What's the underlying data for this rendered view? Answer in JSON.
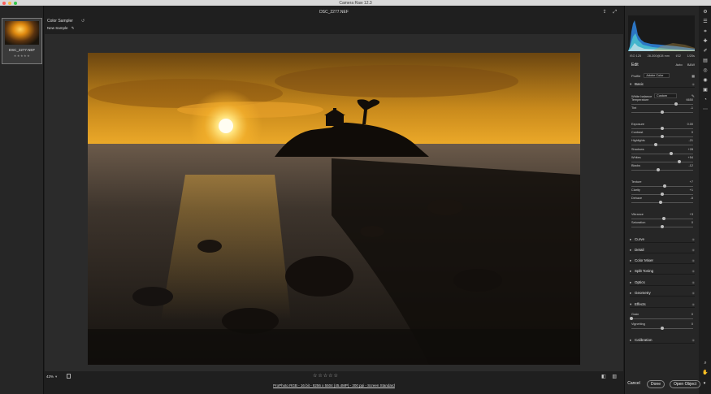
{
  "app": {
    "title": "Camera Raw 12.3"
  },
  "document": {
    "filename": "DSC_2277.NEF"
  },
  "filmstrip": {
    "items": [
      {
        "name": "DSC_2277.NEF",
        "stars": "★★★★★"
      }
    ]
  },
  "color_sampler": {
    "label": "Color Sampler",
    "new_sample": "New Sample"
  },
  "canvas": {
    "zoom": "43%",
    "rating_stars": "☆☆☆☆☆"
  },
  "workflow_options": "ProPhoto RGB - 16 bit - 8256 x 5504 (45.4MP) - 300 ppi - Screen Standard",
  "histogram": {
    "camera_info": [
      "ISO 125",
      "28-300@28 mm",
      "f/22",
      "1/20s"
    ],
    "colors": {
      "blue": "#3aa0ff",
      "cyan": "#44dddd",
      "white": "#eeeeee"
    }
  },
  "edit": {
    "title": "Edit",
    "auto_label": "Auto",
    "bw_label": "B&W",
    "profile_label": "Profile",
    "profile_value": "Adobe Color"
  },
  "basic": {
    "title": "Basic",
    "white_balance_label": "White balance",
    "white_balance_value": "Custom",
    "sliders": [
      {
        "label": "Temperature",
        "value": "6650",
        "position": 0.72
      },
      {
        "label": "Tint",
        "value": "-1",
        "position": 0.5
      },
      {
        "label": "Exposure",
        "value": "0.00",
        "position": 0.5
      },
      {
        "label": "Contrast",
        "value": "0",
        "position": 0.5
      },
      {
        "label": "Highlights",
        "value": "-21",
        "position": 0.4
      },
      {
        "label": "Shadows",
        "value": "+28",
        "position": 0.64
      },
      {
        "label": "Whites",
        "value": "+54",
        "position": 0.77
      },
      {
        "label": "Blacks",
        "value": "-12",
        "position": 0.44
      },
      {
        "label": "Texture",
        "value": "+7",
        "position": 0.54
      },
      {
        "label": "Clarity",
        "value": "+1",
        "position": 0.5
      },
      {
        "label": "Dehaze",
        "value": "-5",
        "position": 0.48
      },
      {
        "label": "Vibrance",
        "value": "+3",
        "position": 0.52
      },
      {
        "label": "Saturation",
        "value": "0",
        "position": 0.5
      }
    ]
  },
  "collapsed_sections": [
    "Curve",
    "Detail",
    "Color Mixer",
    "Split Toning",
    "Optics",
    "Geometry"
  ],
  "effects": {
    "title": "Effects",
    "sliders": [
      {
        "label": "Grain",
        "value": "0",
        "position": 0.0
      },
      {
        "label": "Vignetting",
        "value": "0",
        "position": 0.5
      }
    ]
  },
  "calibration": {
    "title": "Calibration"
  },
  "buttons": {
    "cancel": "Cancel",
    "done": "Done",
    "open_object": "Open Object"
  },
  "icons": {
    "tools": [
      "edit-sliders-icon",
      "crop-icon",
      "healing-icon",
      "brush-icon",
      "graduated-filter-icon",
      "radial-filter-icon",
      "red-eye-icon",
      "snapshots-icon",
      "presets-icon",
      "more-icon"
    ]
  }
}
